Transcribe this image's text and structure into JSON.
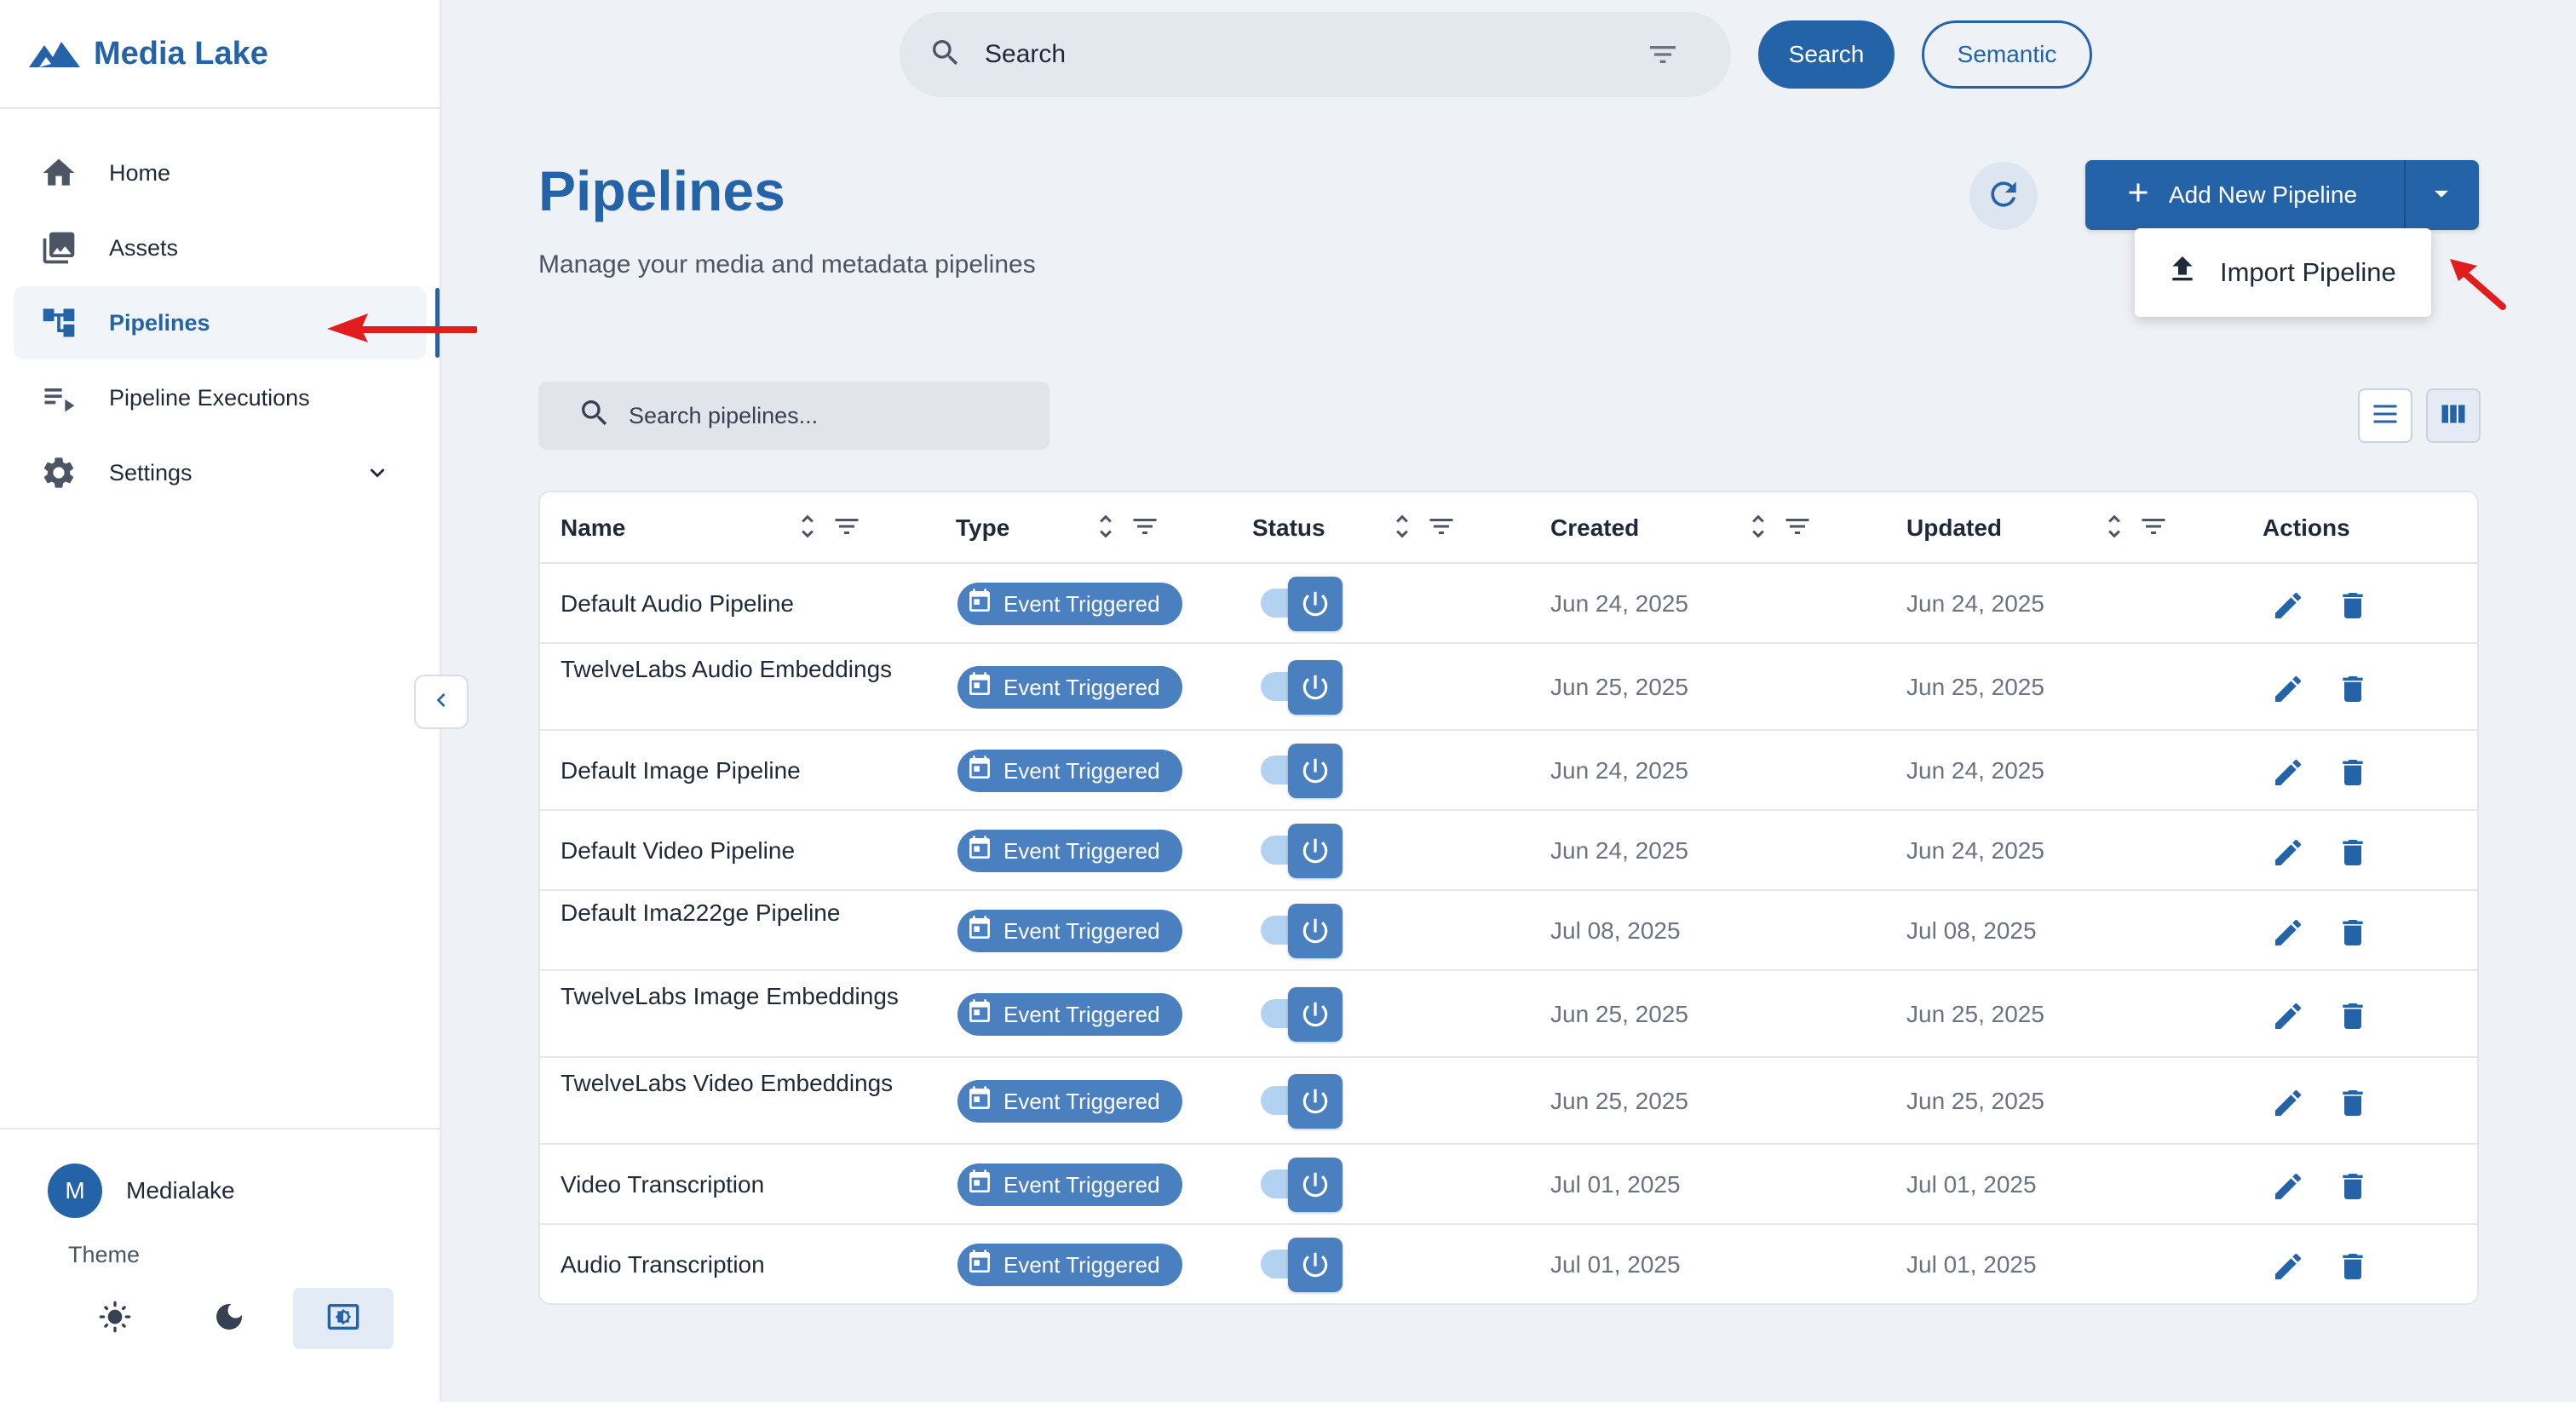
{
  "app": {
    "name": "Media Lake"
  },
  "topbar": {
    "search_label": "Search",
    "search_button": "Search",
    "semantic_button": "Semantic"
  },
  "sidebar": {
    "items": [
      {
        "label": "Home",
        "icon": "home-icon"
      },
      {
        "label": "Assets",
        "icon": "photo-library-icon"
      },
      {
        "label": "Pipelines",
        "icon": "pipeline-icon",
        "active": true
      },
      {
        "label": "Pipeline Executions",
        "icon": "playlist-play-icon"
      },
      {
        "label": "Settings",
        "icon": "gear-icon"
      }
    ],
    "user": {
      "initial": "M",
      "name": "Medialake"
    },
    "theme_label": "Theme"
  },
  "header": {
    "title": "Pipelines",
    "subtitle": "Manage your media and metadata pipelines",
    "add_button": "Add New Pipeline",
    "import_item": "Import Pipeline"
  },
  "filter": {
    "placeholder": "Search pipelines..."
  },
  "table": {
    "columns": [
      "Name",
      "Type",
      "Status",
      "Created",
      "Updated",
      "Actions"
    ],
    "rows": [
      {
        "name": "Default Audio Pipeline",
        "type": "Event Triggered",
        "created": "Jun 24, 2025",
        "updated": "Jun 24, 2025"
      },
      {
        "name": "TwelveLabs Audio Embeddings",
        "type": "Event Triggered",
        "created": "Jun 25, 2025",
        "updated": "Jun 25, 2025"
      },
      {
        "name": "Default Image Pipeline",
        "type": "Event Triggered",
        "created": "Jun 24, 2025",
        "updated": "Jun 24, 2025"
      },
      {
        "name": "Default Video Pipeline",
        "type": "Event Triggered",
        "created": "Jun 24, 2025",
        "updated": "Jun 24, 2025"
      },
      {
        "name": "Default Ima222ge Pipeline",
        "type": "Event Triggered",
        "created": "Jul 08, 2025",
        "updated": "Jul 08, 2025"
      },
      {
        "name": "TwelveLabs Image Embeddings",
        "type": "Event Triggered",
        "created": "Jun 25, 2025",
        "updated": "Jun 25, 2025"
      },
      {
        "name": "TwelveLabs Video Embeddings",
        "type": "Event Triggered",
        "created": "Jun 25, 2025",
        "updated": "Jun 25, 2025"
      },
      {
        "name": "Video Transcription",
        "type": "Event Triggered",
        "created": "Jul 01, 2025",
        "updated": "Jul 01, 2025"
      },
      {
        "name": "Audio Transcription",
        "type": "Event Triggered",
        "created": "Jul 01, 2025",
        "updated": "Jul 01, 2025"
      }
    ]
  },
  "colors": {
    "brand": "#2563a8",
    "chip": "#4a7fc0",
    "annotation_arrow": "#e11d1d"
  }
}
